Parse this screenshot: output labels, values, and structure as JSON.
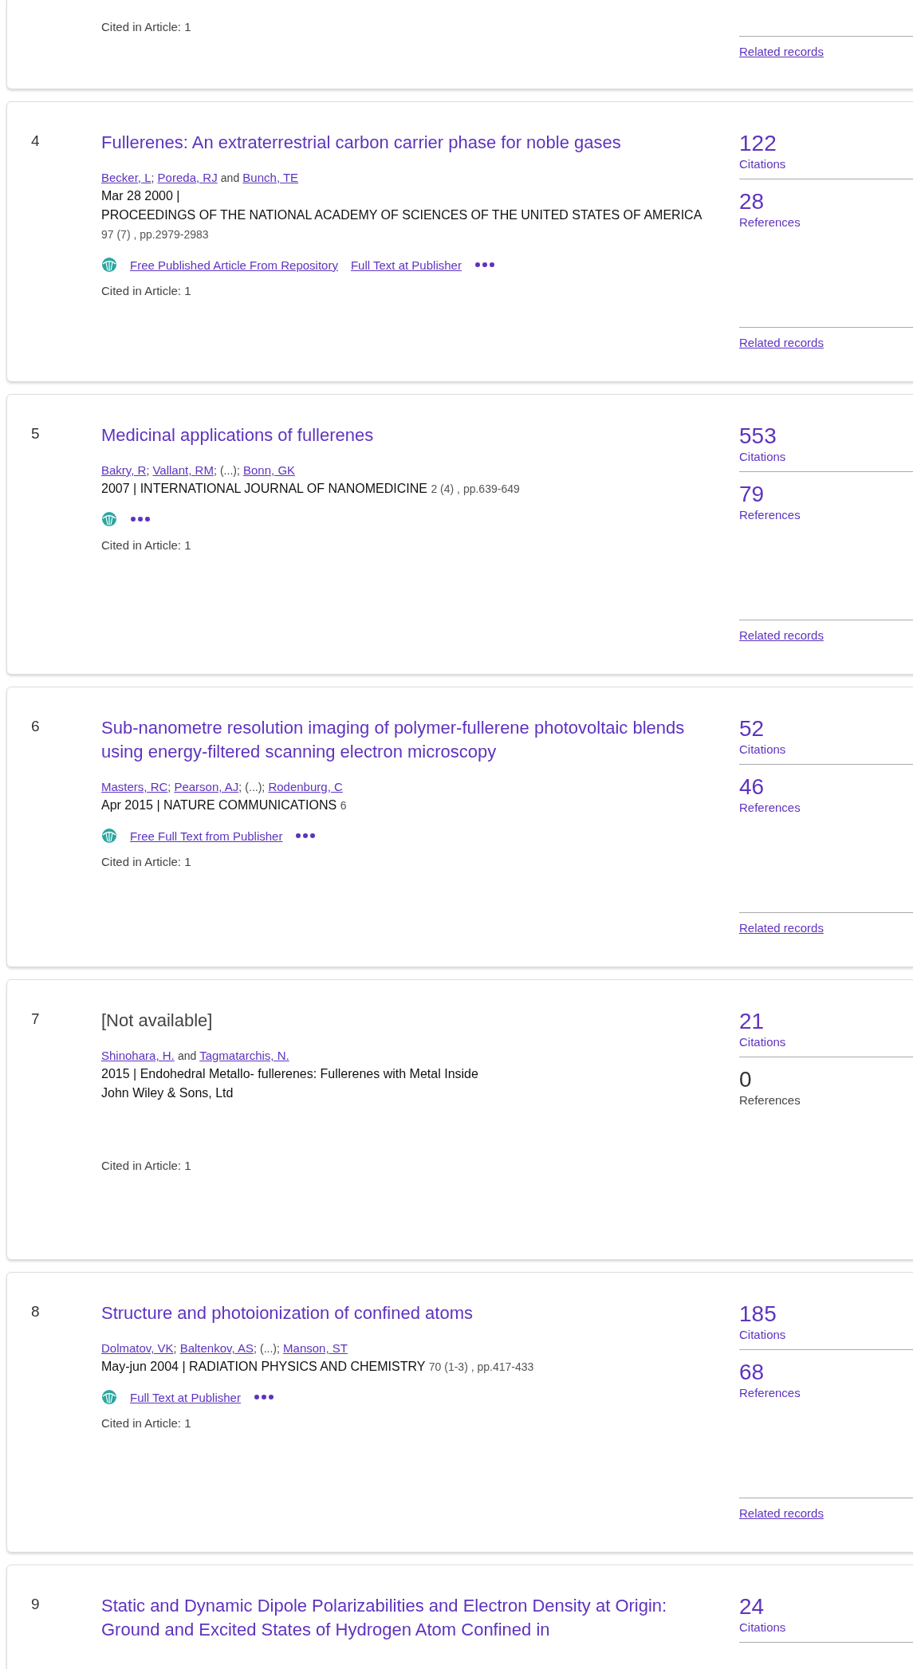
{
  "records": [
    {
      "cited": "Cited in Article: 1",
      "related": "Related records"
    },
    {
      "number": "4",
      "title": "Fullerenes: An extraterrestrial carbon carrier phase for noble gases",
      "title_available": true,
      "authors": [
        {
          "text": "Becker, L",
          "kind": "author"
        },
        {
          "text": ";",
          "kind": "sep"
        },
        {
          "text": "Poreda, RJ",
          "kind": "author"
        },
        {
          "text": "and",
          "kind": "word"
        },
        {
          "text": "Bunch, TE",
          "kind": "author"
        }
      ],
      "date": "Mar 28 2000 |",
      "journal": "PROCEEDINGS OF THE NATIONAL ACADEMY OF SCIENCES OF THE UNITED STATES OF AMERICA",
      "details": "97 (7) , pp.2979-2983",
      "access_icon": true,
      "links": [
        "Free Published Article From Repository",
        "Full Text at Publisher"
      ],
      "more_menu": true,
      "cited": "Cited in Article: 1",
      "citations": {
        "count": "122",
        "label": "Citations",
        "linked": true
      },
      "references": {
        "count": "28",
        "label": "References",
        "linked": true
      },
      "related": "Related records"
    },
    {
      "number": "5",
      "title": "Medicinal applications of fullerenes",
      "title_available": true,
      "authors": [
        {
          "text": "Bakry, R",
          "kind": "author"
        },
        {
          "text": ";",
          "kind": "sep"
        },
        {
          "text": "Vallant, RM",
          "kind": "author"
        },
        {
          "text": ";",
          "kind": "sep"
        },
        {
          "text": "(...);",
          "kind": "word"
        },
        {
          "text": "Bonn, GK",
          "kind": "author"
        }
      ],
      "date": "2007 |",
      "journal": "INTERNATIONAL JOURNAL OF NANOMEDICINE",
      "details": "2 (4) , pp.639-649",
      "access_icon": true,
      "more_menu": true,
      "cited": "Cited in Article: 1",
      "citations": {
        "count": "553",
        "label": "Citations",
        "linked": true
      },
      "references": {
        "count": "79",
        "label": "References",
        "linked": true
      },
      "related": "Related records"
    },
    {
      "number": "6",
      "title": "Sub-nanometre resolution imaging of polymer-fullerene photovoltaic blends using energy-filtered scanning electron microscopy",
      "title_available": true,
      "authors": [
        {
          "text": "Masters, RC",
          "kind": "author"
        },
        {
          "text": ";",
          "kind": "sep"
        },
        {
          "text": "Pearson, AJ",
          "kind": "author"
        },
        {
          "text": ";",
          "kind": "sep"
        },
        {
          "text": "(...);",
          "kind": "word"
        },
        {
          "text": "Rodenburg, C",
          "kind": "author"
        }
      ],
      "date": "Apr 2015 |",
      "journal": "NATURE COMMUNICATIONS",
      "details": "6",
      "access_icon": true,
      "links": [
        "Free Full Text from Publisher"
      ],
      "more_menu": true,
      "cited": "Cited in Article: 1",
      "citations": {
        "count": "52",
        "label": "Citations",
        "linked": true
      },
      "references": {
        "count": "46",
        "label": "References",
        "linked": true
      },
      "related": "Related records"
    },
    {
      "number": "7",
      "title": "[Not available]",
      "title_available": false,
      "authors": [
        {
          "text": "Shinohara, H.",
          "kind": "author"
        },
        {
          "text": "and",
          "kind": "word"
        },
        {
          "text": "Tagmatarchis, N.",
          "kind": "author"
        }
      ],
      "date": "2015 |",
      "journal": "Endohedral Metallo- fullerenes: Fullerenes with Metal Inside",
      "publisher": "John Wiley & Sons, Ltd",
      "access_icon": false,
      "more_menu": false,
      "cited": "Cited in Article: 1",
      "citations": {
        "count": "21",
        "label": "Citations",
        "linked": true
      },
      "references": {
        "count": "0",
        "label": "References",
        "linked": false
      }
    },
    {
      "number": "8",
      "title": "Structure and photoionization of confined atoms",
      "title_available": true,
      "authors": [
        {
          "text": "Dolmatov, VK",
          "kind": "author"
        },
        {
          "text": ";",
          "kind": "sep"
        },
        {
          "text": "Baltenkov, AS",
          "kind": "author"
        },
        {
          "text": ";",
          "kind": "sep"
        },
        {
          "text": "(...);",
          "kind": "word"
        },
        {
          "text": "Manson, ST",
          "kind": "author"
        }
      ],
      "date": "May-jun 2004 |",
      "journal": "RADIATION PHYSICS AND CHEMISTRY",
      "details": "70 (1-3) , pp.417-433",
      "access_icon": true,
      "links": [
        "Full Text at Publisher"
      ],
      "more_menu": true,
      "cited": "Cited in Article: 1",
      "citations": {
        "count": "185",
        "label": "Citations",
        "linked": true
      },
      "references": {
        "count": "68",
        "label": "References",
        "linked": true
      },
      "related": "Related records"
    },
    {
      "number": "9",
      "title": "Static and Dynamic Dipole Polarizabilities and Electron Density at Origin: Ground and Excited States of Hydrogen Atom Confined in",
      "title_available": true,
      "citations": {
        "count": "24",
        "label": "Citations",
        "linked": true
      }
    }
  ]
}
